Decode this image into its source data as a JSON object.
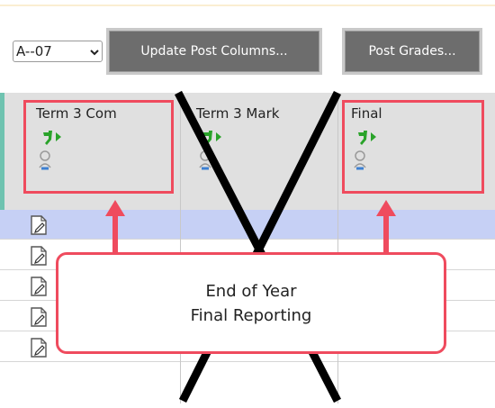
{
  "toolbar": {
    "term_select_value": "A--07",
    "update_label": "Update Post Columns...",
    "post_label": "Post Grades..."
  },
  "columns": [
    {
      "title": "Term 3 Com"
    },
    {
      "title": "Term 3 Mark"
    },
    {
      "title": "Final"
    }
  ],
  "rows": [
    {
      "highlighted": true
    },
    {
      "highlighted": false
    },
    {
      "highlighted": false
    },
    {
      "highlighted": false
    },
    {
      "highlighted": false
    }
  ],
  "callout": {
    "line1": "End of Year",
    "line2": "Final Reporting"
  },
  "colors": {
    "annotation_red": "#ef4b5e",
    "button_gray": "#6d6d6d",
    "highlight_row": "#c6d0f5",
    "icon_green": "#2aa32a"
  },
  "icons": [
    "dropdown-chevron-icon",
    "post-arrow-icon",
    "user-search-icon",
    "edit-note-icon"
  ]
}
